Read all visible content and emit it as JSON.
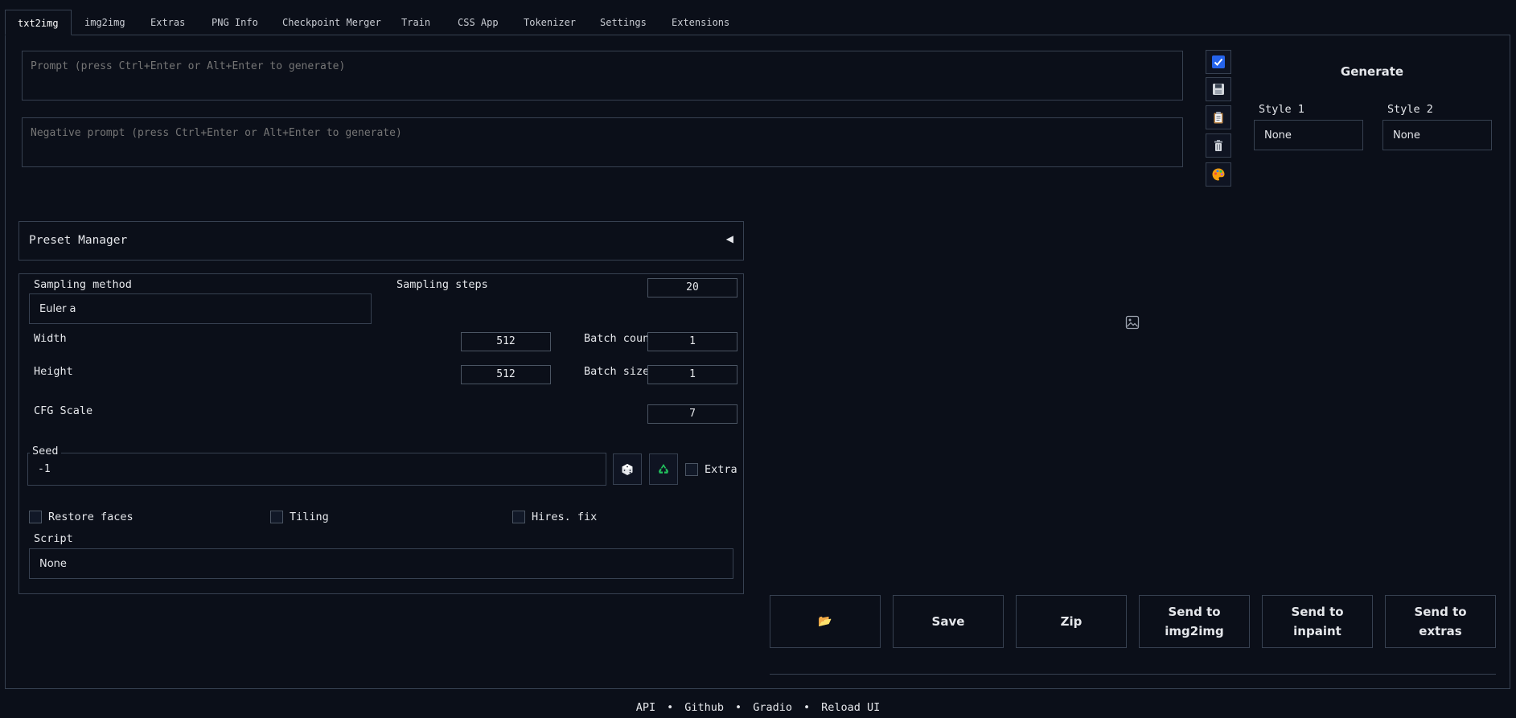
{
  "tabs": [
    {
      "label": "txt2img",
      "active": true
    },
    {
      "label": "img2img"
    },
    {
      "label": "Extras"
    },
    {
      "label": "PNG Info"
    },
    {
      "label": "Checkpoint Merger"
    },
    {
      "label": "Train"
    },
    {
      "label": "CSS App"
    },
    {
      "label": "Tokenizer"
    },
    {
      "label": "Settings"
    },
    {
      "label": "Extensions"
    }
  ],
  "prompt": {
    "placeholder": "Prompt (press Ctrl+Enter or Alt+Enter to generate)",
    "negative_placeholder": "Negative prompt (press Ctrl+Enter or Alt+Enter to generate)"
  },
  "toolbar": {
    "icons": [
      "checkbox-icon",
      "save-icon",
      "clipboard-icon",
      "trash-icon",
      "palette-icon"
    ]
  },
  "generate": {
    "label": "Generate"
  },
  "styles": {
    "style1_label": "Style 1",
    "style1_value": "None",
    "style2_label": "Style 2",
    "style2_value": "None"
  },
  "preset_manager": {
    "label": "Preset Manager",
    "arrow": "◀"
  },
  "params": {
    "sampling_method_label": "Sampling method",
    "sampling_method_value": "Euler a",
    "sampling_steps_label": "Sampling steps",
    "sampling_steps_value": "20",
    "width_label": "Width",
    "width_value": "512",
    "height_label": "Height",
    "height_value": "512",
    "batch_count_label": "Batch count",
    "batch_count_value": "1",
    "batch_size_label": "Batch size",
    "batch_size_value": "1",
    "cfg_label": "CFG Scale",
    "cfg_value": "7",
    "seed_label": "Seed",
    "seed_value": "-1",
    "extra_label": "Extra",
    "restore_faces_label": "Restore faces",
    "tiling_label": "Tiling",
    "hires_label": "Hires. fix",
    "script_label": "Script",
    "script_value": "None"
  },
  "output_buttons": {
    "folder_icon": "📂",
    "save": "Save",
    "zip": "Zip",
    "send_img2img_1": "Send to",
    "send_img2img_2": "img2img",
    "send_inpaint_1": "Send to",
    "send_inpaint_2": "inpaint",
    "send_extras_1": "Send to",
    "send_extras_2": "extras"
  },
  "footer": {
    "api": "API",
    "github": "Github",
    "gradio": "Gradio",
    "reload": "Reload UI",
    "separator": "•"
  },
  "colors": {
    "background": "#0b0f19",
    "border": "#374151",
    "check_accent": "#2563eb"
  }
}
